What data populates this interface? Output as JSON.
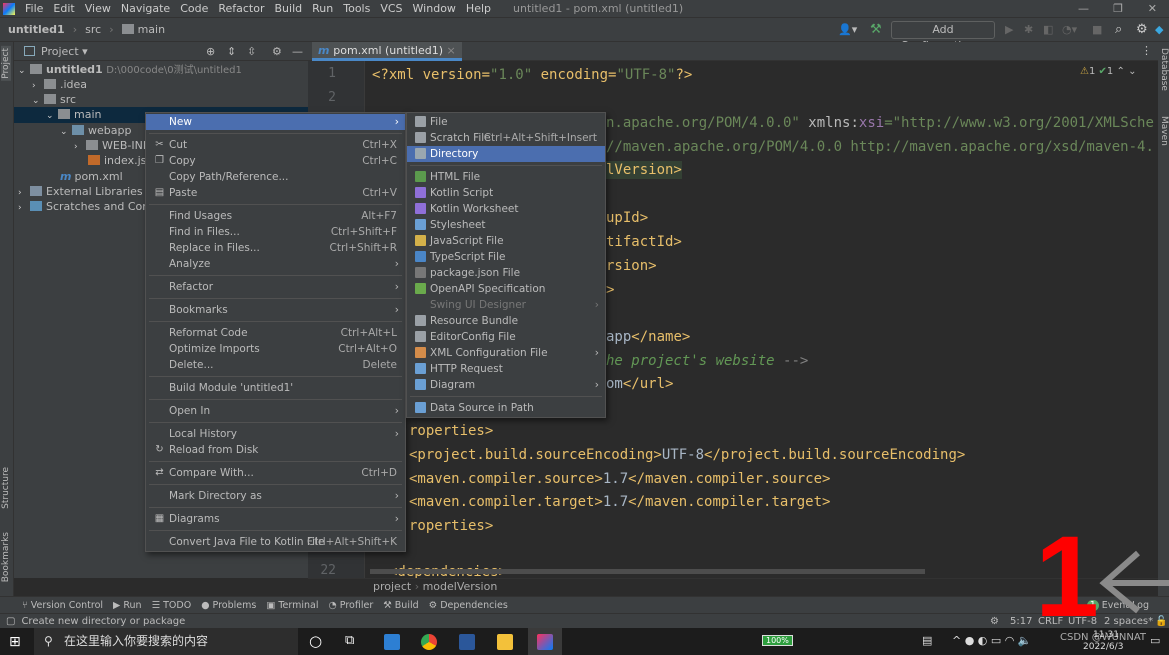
{
  "window": {
    "title": "untitled1 - pom.xml (untitled1)"
  },
  "menubar": [
    "File",
    "Edit",
    "View",
    "Navigate",
    "Code",
    "Refactor",
    "Build",
    "Run",
    "Tools",
    "VCS",
    "Window",
    "Help"
  ],
  "breadcrumb_nav": [
    "untitled1",
    "src",
    "main"
  ],
  "toolbar": {
    "add_configuration": "Add Configuration..."
  },
  "project_panel": {
    "title": "Project",
    "side_label": "Project",
    "tree": [
      {
        "label": "untitled1",
        "path": "D:\\000code\\0测试\\untitled1"
      },
      {
        "label": ".idea"
      },
      {
        "label": "src"
      },
      {
        "label": "main"
      },
      {
        "label": "webapp"
      },
      {
        "label": "WEB-INF"
      },
      {
        "label": "index.jsp"
      },
      {
        "label": "pom.xml"
      },
      {
        "label": "External Libraries"
      },
      {
        "label": "Scratches and Consoles"
      }
    ]
  },
  "editor": {
    "tab": "pom.xml (untitled1)",
    "line_numbers": [
      "1",
      "2",
      "22"
    ],
    "inspections": {
      "warnings": "1",
      "ok": "1"
    },
    "code": [
      [
        {
          "t": "<?xml version=",
          "k": "tag"
        },
        {
          "t": "\"1.0\"",
          "k": "str"
        },
        {
          "t": " encoding=",
          "k": "tag"
        },
        {
          "t": "\"UTF-8\"",
          "k": "str"
        },
        {
          "t": "?>",
          "k": "tag"
        }
      ],
      [
        {
          "t": "n.apache.org/POM/4.0.0\"",
          "k": "str"
        },
        {
          "t": " xmlns:",
          "k": "attr"
        },
        {
          "t": "xsi",
          "k": "ns"
        },
        {
          "t": "=\"http://www.w3.org/2001/XMLSche",
          "k": "str"
        }
      ],
      [
        {
          "t": "//maven.apache.org/POM/4.0.0 http://maven.apache.org/xsd/maven-4.",
          "k": "str"
        }
      ],
      [
        {
          "t": "lVersion>",
          "k": "tag"
        }
      ],
      [
        {
          "t": "upId>",
          "k": "tag"
        }
      ],
      [
        {
          "t": "tifactId>",
          "k": "tag"
        }
      ],
      [
        {
          "t": "rsion>",
          "k": "tag"
        }
      ],
      [
        {
          "t": ">",
          "k": "tag"
        }
      ],
      [
        {
          "t": "app",
          "k": "txt"
        },
        {
          "t": "</name>",
          "k": "tag"
        }
      ],
      [
        {
          "t": "he project's website ",
          "k": "com"
        },
        {
          "t": "-->",
          "k": "cg"
        }
      ],
      [
        {
          "t": "om",
          "k": "txt"
        },
        {
          "t": "</url>",
          "k": "tag"
        }
      ],
      [
        {
          "t": "roperties>",
          "k": "tag"
        }
      ],
      [
        {
          "t": "<project.build.sourceEncoding>",
          "k": "tag"
        },
        {
          "t": "UTF-8",
          "k": "txt"
        },
        {
          "t": "</project.build.sourceEncoding>",
          "k": "tag"
        }
      ],
      [
        {
          "t": "<maven.compiler.source>",
          "k": "tag"
        },
        {
          "t": "1.7",
          "k": "txt"
        },
        {
          "t": "</maven.compiler.source>",
          "k": "tag"
        }
      ],
      [
        {
          "t": "<maven.compiler.target>",
          "k": "tag"
        },
        {
          "t": "1.7",
          "k": "txt"
        },
        {
          "t": "</maven.compiler.target>",
          "k": "tag"
        }
      ],
      [
        {
          "t": "roperties>",
          "k": "tag"
        }
      ],
      [
        {
          "t": "<dependencies>",
          "k": "tag"
        }
      ]
    ],
    "breadcrumbs": [
      "project",
      "modelVersion"
    ]
  },
  "context_menu": [
    {
      "label": "New",
      "submenu": true,
      "active": true
    },
    {
      "sep": true
    },
    {
      "label": "Cut",
      "shortcut": "Ctrl+X",
      "icon": "scissors-icon",
      "glyph": "✂"
    },
    {
      "label": "Copy",
      "shortcut": "Ctrl+C",
      "icon": "copy-icon",
      "glyph": "❐"
    },
    {
      "label": "Copy Path/Reference..."
    },
    {
      "label": "Paste",
      "shortcut": "Ctrl+V",
      "icon": "paste-icon",
      "glyph": "▤"
    },
    {
      "sep": true
    },
    {
      "label": "Find Usages",
      "shortcut": "Alt+F7"
    },
    {
      "label": "Find in Files...",
      "shortcut": "Ctrl+Shift+F"
    },
    {
      "label": "Replace in Files...",
      "shortcut": "Ctrl+Shift+R"
    },
    {
      "label": "Analyze",
      "submenu": true
    },
    {
      "sep": true
    },
    {
      "label": "Refactor",
      "submenu": true
    },
    {
      "sep": true
    },
    {
      "label": "Bookmarks",
      "submenu": true
    },
    {
      "sep": true
    },
    {
      "label": "Reformat Code",
      "shortcut": "Ctrl+Alt+L"
    },
    {
      "label": "Optimize Imports",
      "shortcut": "Ctrl+Alt+O"
    },
    {
      "label": "Delete...",
      "shortcut": "Delete"
    },
    {
      "sep": true
    },
    {
      "label": "Build Module 'untitled1'"
    },
    {
      "sep": true
    },
    {
      "label": "Open In",
      "submenu": true
    },
    {
      "sep": true
    },
    {
      "label": "Local History",
      "submenu": true
    },
    {
      "label": "Reload from Disk",
      "icon": "reload-icon",
      "glyph": "↻"
    },
    {
      "sep": true
    },
    {
      "label": "Compare With...",
      "shortcut": "Ctrl+D",
      "icon": "compare-icon",
      "glyph": "⇄"
    },
    {
      "sep": true
    },
    {
      "label": "Mark Directory as",
      "submenu": true
    },
    {
      "sep": true
    },
    {
      "label": "Diagrams",
      "submenu": true,
      "icon": "diagram-icon",
      "glyph": "▦"
    },
    {
      "sep": true
    },
    {
      "label": "Convert Java File to Kotlin File",
      "shortcut": "Ctrl+Alt+Shift+K"
    }
  ],
  "new_submenu": [
    {
      "label": "File",
      "icon": "file-icon",
      "color": "#9aa0a6"
    },
    {
      "label": "Scratch File",
      "shortcut": "Ctrl+Alt+Shift+Insert",
      "icon": "scratch-file-icon",
      "color": "#9aa0a6"
    },
    {
      "label": "Directory",
      "active": true,
      "icon": "folder-icon",
      "color": "#9aa7b0"
    },
    {
      "sep": true
    },
    {
      "label": "HTML File",
      "icon": "html-file-icon",
      "color": "#5b9a4d"
    },
    {
      "label": "Kotlin Script",
      "icon": "kotlin-icon",
      "color": "#8f6fd8"
    },
    {
      "label": "Kotlin Worksheet",
      "icon": "kotlin-icon",
      "color": "#8f6fd8"
    },
    {
      "label": "Stylesheet",
      "icon": "css-icon",
      "color": "#6a9fd4"
    },
    {
      "label": "JavaScript File",
      "icon": "js-icon",
      "color": "#d4b14a"
    },
    {
      "label": "TypeScript File",
      "icon": "ts-icon",
      "color": "#4a86c7"
    },
    {
      "label": "package.json File",
      "icon": "npm-icon",
      "color": "#777777"
    },
    {
      "label": "OpenAPI Specification",
      "icon": "openapi-icon",
      "color": "#6aaa4c"
    },
    {
      "label": "Swing UI Designer",
      "disabled": true,
      "submenu": true
    },
    {
      "label": "Resource Bundle",
      "icon": "bundle-icon",
      "color": "#9aa0a6"
    },
    {
      "label": "EditorConfig File",
      "icon": "gear-icon",
      "color": "#9aa0a6"
    },
    {
      "label": "XML Configuration File",
      "submenu": true,
      "icon": "xml-icon",
      "color": "#d48c4a"
    },
    {
      "label": "HTTP Request",
      "icon": "http-icon",
      "color": "#6a9fd4"
    },
    {
      "label": "Diagram",
      "submenu": true,
      "icon": "diagram-icon",
      "color": "#6a9fd4"
    },
    {
      "sep": true
    },
    {
      "label": "Data Source in Path",
      "icon": "datasource-icon",
      "color": "#6a9fd4"
    }
  ],
  "right_strip": [
    "Database",
    "Maven"
  ],
  "left_strip_bottom": [
    "Structure",
    "Bookmarks"
  ],
  "tool_windows": [
    "Version Control",
    "Run",
    "TODO",
    "Problems",
    "Terminal",
    "Profiler",
    "Build",
    "Dependencies"
  ],
  "event_log": {
    "label": "Event Log",
    "badge": "1"
  },
  "status": {
    "message": "Create new directory or package",
    "position": "5:17",
    "line_sep": "CRLF",
    "encoding": "UTF-8",
    "indent": "2 spaces*"
  },
  "taskbar": {
    "search_placeholder": "在这里输入你要搜索的内容",
    "battery": "100%",
    "time": "11:31",
    "date": "2022/6/3",
    "watermark": "CSDN @WUNNAT"
  },
  "annotation": {
    "number": "1",
    "color": "#ff0000"
  },
  "colors": {
    "accent": "#4b6eaf",
    "panel": "#3c3f41",
    "editor": "#2b2b2b"
  }
}
